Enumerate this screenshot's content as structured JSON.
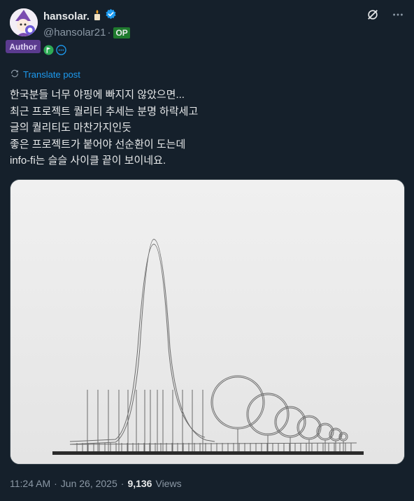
{
  "author": {
    "display_name": "hansolar.",
    "name_emoji": "candle-icon",
    "verified_icon": "verified-badge-icon",
    "handle": "@hansolar21",
    "separator": "·",
    "op_label": "OP",
    "author_badge": "Author",
    "flairs": [
      "flag-icon",
      "more-dots-icon"
    ]
  },
  "header_actions": [
    "grok-icon",
    "more-options-icon"
  ],
  "translate_label": "Translate post",
  "post_lines": [
    "한국분들 너무 야핑에 빠지지 않았으면...",
    "최근 프로젝트 퀄리티 추세는 분명 하락세고",
    "글의 퀄리티도 마찬가지인듯",
    "좋은 프로젝트가 붙어야 선순환이 도는데",
    "info-fi는 슬슬 사이클 끝이 보이네요."
  ],
  "media": {
    "description_icon": "roller-coaster-model-image"
  },
  "meta": {
    "time": "11:24 AM",
    "dot": "·",
    "date": "Jun 26, 2025",
    "dot2": "·",
    "views_count": "9,136",
    "views_label": "Views"
  },
  "colors": {
    "background": "#15202b",
    "link": "#1d9bf0",
    "verified": "#1d9bf0",
    "op_badge": "#1f7a2e",
    "author_badge": "#5b3b8f"
  }
}
